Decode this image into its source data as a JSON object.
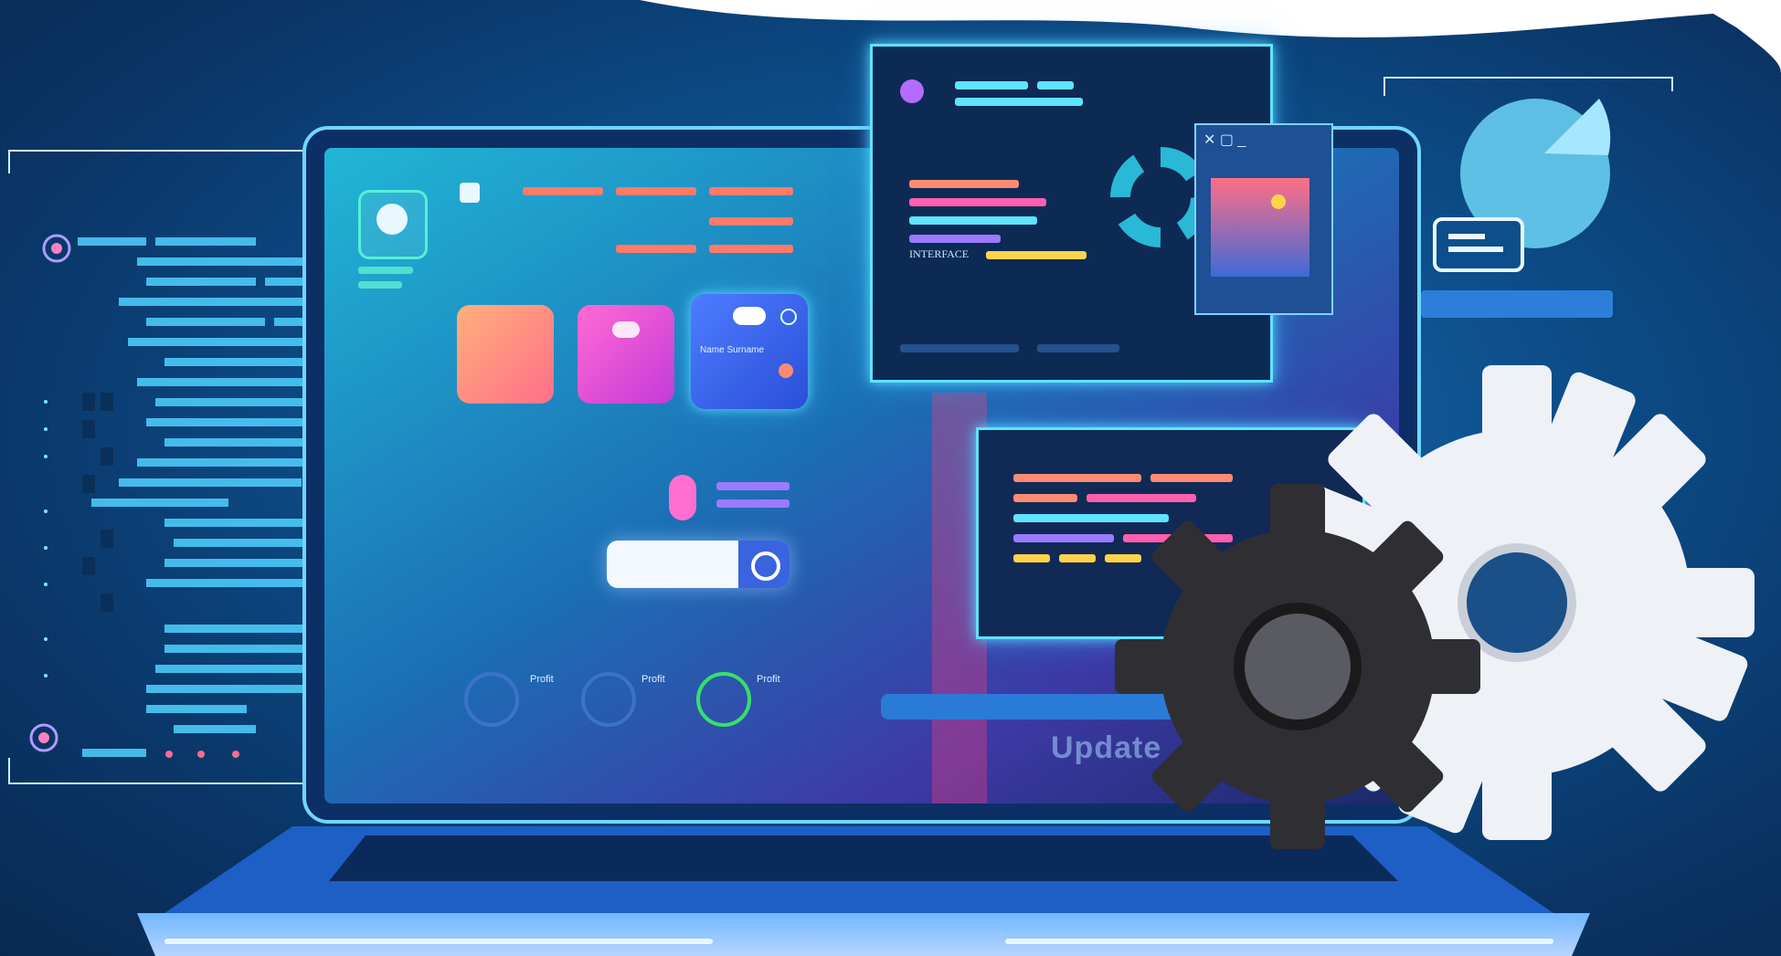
{
  "scene": {
    "card_label": "Name Surname",
    "window_label": "INTERFACE",
    "profit_labels": [
      "Profit",
      "Profit",
      "Profit"
    ],
    "update_label": "Update",
    "window_controls": "✕ ▢ _"
  },
  "colors": {
    "background": "#0d4f8c",
    "cyan": "#5fe3ff",
    "coral": "#ff8a73",
    "pink": "#ff4fbf",
    "purple": "#9a7bff",
    "yellow": "#ffd34a",
    "green": "#35e06b"
  },
  "icons": [
    "user-icon",
    "chart-icon",
    "users-icon",
    "gear-icon",
    "image-icon",
    "pie-chart-icon",
    "search-icon"
  ]
}
